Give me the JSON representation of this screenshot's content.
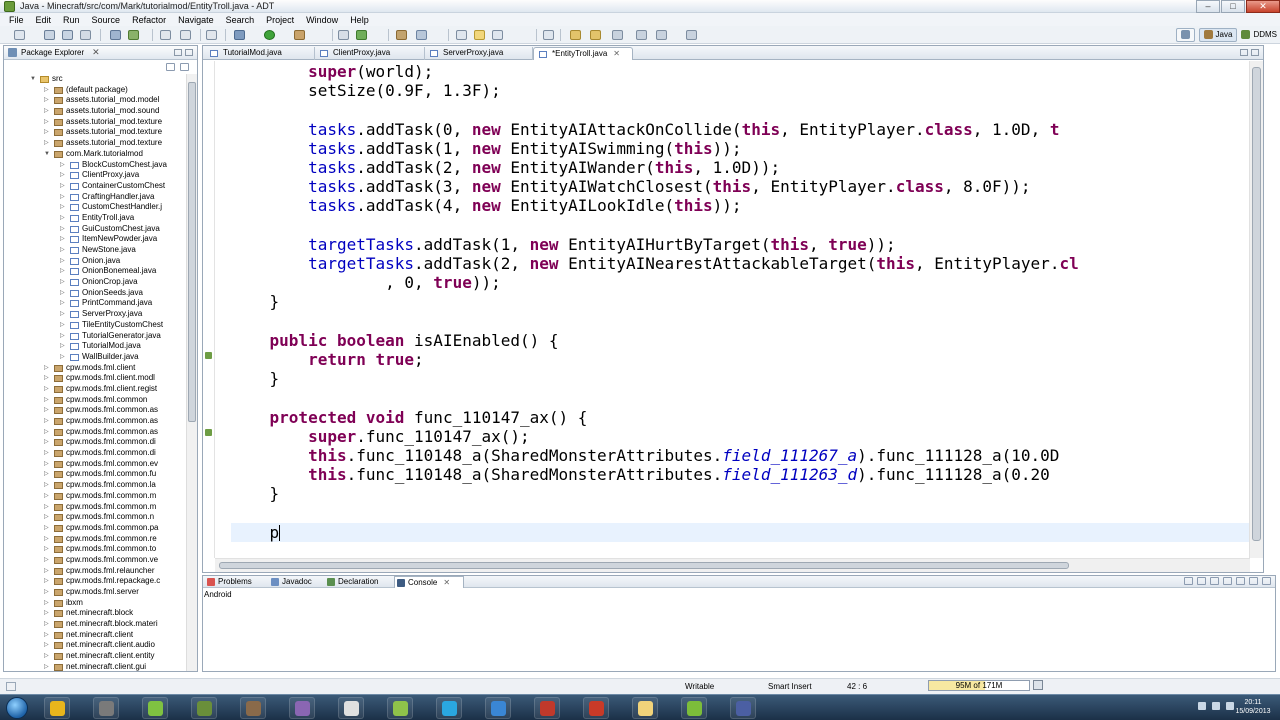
{
  "window": {
    "title": "Java - Minecraft/src/com/Mark/tutorialmod/EntityTroll.java - ADT",
    "minimize": "–",
    "maximize": "□",
    "close": "✕"
  },
  "menu": [
    "File",
    "Edit",
    "Run",
    "Source",
    "Refactor",
    "Navigate",
    "Search",
    "Project",
    "Window",
    "Help"
  ],
  "perspectives": {
    "java": "Java",
    "ddms": "DDMS"
  },
  "package_explorer": {
    "title": "Package Explorer",
    "close": "✕",
    "tree": [
      {
        "label": "src",
        "level": 1,
        "icon": "folder",
        "twisty": "▼"
      },
      {
        "label": "(default package)",
        "level": 2,
        "icon": "pkg",
        "twisty": "▷"
      },
      {
        "label": "assets.tutorial_mod.model",
        "level": 2,
        "icon": "pkg",
        "twisty": "▷"
      },
      {
        "label": "assets.tutorial_mod.sound",
        "level": 2,
        "icon": "pkg",
        "twisty": "▷"
      },
      {
        "label": "assets.tutorial_mod.texture",
        "level": 2,
        "icon": "pkg",
        "twisty": "▷"
      },
      {
        "label": "assets.tutorial_mod.texture",
        "level": 2,
        "icon": "pkg",
        "twisty": "▷"
      },
      {
        "label": "assets.tutorial_mod.texture",
        "level": 2,
        "icon": "pkg",
        "twisty": "▷"
      },
      {
        "label": "com.Mark.tutorialmod",
        "level": 2,
        "icon": "pkg",
        "twisty": "▼"
      },
      {
        "label": "BlockCustomChest.java",
        "level": 3,
        "icon": "java",
        "twisty": "▷"
      },
      {
        "label": "ClientProxy.java",
        "level": 3,
        "icon": "java",
        "twisty": "▷"
      },
      {
        "label": "ContainerCustomChest",
        "level": 3,
        "icon": "java",
        "twisty": "▷"
      },
      {
        "label": "CraftingHandler.java",
        "level": 3,
        "icon": "java",
        "twisty": "▷"
      },
      {
        "label": "CustomChestHandler.j",
        "level": 3,
        "icon": "java",
        "twisty": "▷"
      },
      {
        "label": "EntityTroll.java",
        "level": 3,
        "icon": "java",
        "twisty": "▷"
      },
      {
        "label": "GuiCustomChest.java",
        "level": 3,
        "icon": "java",
        "twisty": "▷"
      },
      {
        "label": "ItemNewPowder.java",
        "level": 3,
        "icon": "java",
        "twisty": "▷"
      },
      {
        "label": "NewStone.java",
        "level": 3,
        "icon": "java",
        "twisty": "▷"
      },
      {
        "label": "Onion.java",
        "level": 3,
        "icon": "java",
        "twisty": "▷"
      },
      {
        "label": "OnionBonemeal.java",
        "level": 3,
        "icon": "java",
        "twisty": "▷"
      },
      {
        "label": "OnionCrop.java",
        "level": 3,
        "icon": "java",
        "twisty": "▷"
      },
      {
        "label": "OnionSeeds.java",
        "level": 3,
        "icon": "java",
        "twisty": "▷"
      },
      {
        "label": "PrintCommand.java",
        "level": 3,
        "icon": "java",
        "twisty": "▷"
      },
      {
        "label": "ServerProxy.java",
        "level": 3,
        "icon": "java",
        "twisty": "▷"
      },
      {
        "label": "TileEntityCustomChest",
        "level": 3,
        "icon": "java",
        "twisty": "▷"
      },
      {
        "label": "TutorialGenerator.java",
        "level": 3,
        "icon": "java",
        "twisty": "▷"
      },
      {
        "label": "TutorialMod.java",
        "level": 3,
        "icon": "java",
        "twisty": "▷"
      },
      {
        "label": "WallBuilder.java",
        "level": 3,
        "icon": "java",
        "twisty": "▷"
      },
      {
        "label": "cpw.mods.fml.client",
        "level": 2,
        "icon": "pkg",
        "twisty": "▷"
      },
      {
        "label": "cpw.mods.fml.client.modl",
        "level": 2,
        "icon": "pkg",
        "twisty": "▷"
      },
      {
        "label": "cpw.mods.fml.client.regist",
        "level": 2,
        "icon": "pkg",
        "twisty": "▷"
      },
      {
        "label": "cpw.mods.fml.common",
        "level": 2,
        "icon": "pkg",
        "twisty": "▷"
      },
      {
        "label": "cpw.mods.fml.common.as",
        "level": 2,
        "icon": "pkg",
        "twisty": "▷"
      },
      {
        "label": "cpw.mods.fml.common.as",
        "level": 2,
        "icon": "pkg",
        "twisty": "▷"
      },
      {
        "label": "cpw.mods.fml.common.as",
        "level": 2,
        "icon": "pkg",
        "twisty": "▷"
      },
      {
        "label": "cpw.mods.fml.common.di",
        "level": 2,
        "icon": "pkg",
        "twisty": "▷"
      },
      {
        "label": "cpw.mods.fml.common.di",
        "level": 2,
        "icon": "pkg",
        "twisty": "▷"
      },
      {
        "label": "cpw.mods.fml.common.ev",
        "level": 2,
        "icon": "pkg",
        "twisty": "▷"
      },
      {
        "label": "cpw.mods.fml.common.fu",
        "level": 2,
        "icon": "pkg",
        "twisty": "▷"
      },
      {
        "label": "cpw.mods.fml.common.la",
        "level": 2,
        "icon": "pkg",
        "twisty": "▷"
      },
      {
        "label": "cpw.mods.fml.common.m",
        "level": 2,
        "icon": "pkg",
        "twisty": "▷"
      },
      {
        "label": "cpw.mods.fml.common.m",
        "level": 2,
        "icon": "pkg",
        "twisty": "▷"
      },
      {
        "label": "cpw.mods.fml.common.n",
        "level": 2,
        "icon": "pkg",
        "twisty": "▷"
      },
      {
        "label": "cpw.mods.fml.common.pa",
        "level": 2,
        "icon": "pkg",
        "twisty": "▷"
      },
      {
        "label": "cpw.mods.fml.common.re",
        "level": 2,
        "icon": "pkg",
        "twisty": "▷"
      },
      {
        "label": "cpw.mods.fml.common.to",
        "level": 2,
        "icon": "pkg",
        "twisty": "▷"
      },
      {
        "label": "cpw.mods.fml.common.ve",
        "level": 2,
        "icon": "pkg",
        "twisty": "▷"
      },
      {
        "label": "cpw.mods.fml.relauncher",
        "level": 2,
        "icon": "pkg",
        "twisty": "▷"
      },
      {
        "label": "cpw.mods.fml.repackage.c",
        "level": 2,
        "icon": "pkg",
        "twisty": "▷"
      },
      {
        "label": "cpw.mods.fml.server",
        "level": 2,
        "icon": "pkg",
        "twisty": "▷"
      },
      {
        "label": "ibxm",
        "level": 2,
        "icon": "pkg",
        "twisty": "▷"
      },
      {
        "label": "net.minecraft.block",
        "level": 2,
        "icon": "pkg",
        "twisty": "▷"
      },
      {
        "label": "net.minecraft.block.materi",
        "level": 2,
        "icon": "pkg",
        "twisty": "▷"
      },
      {
        "label": "net.minecraft.client",
        "level": 2,
        "icon": "pkg",
        "twisty": "▷"
      },
      {
        "label": "net.minecraft.client.audio",
        "level": 2,
        "icon": "pkg",
        "twisty": "▷"
      },
      {
        "label": "net.minecraft.client.entity",
        "level": 2,
        "icon": "pkg",
        "twisty": "▷"
      },
      {
        "label": "net.minecraft.client.gui",
        "level": 2,
        "icon": "pkg",
        "twisty": "▷"
      }
    ]
  },
  "editor": {
    "tabs": [
      {
        "label": "TutorialMod.java",
        "active": false
      },
      {
        "label": "ClientProxy.java",
        "active": false
      },
      {
        "label": "ServerProxy.java",
        "active": false
      },
      {
        "label": "*EntityTroll.java",
        "active": true
      }
    ],
    "tab_close": "✕",
    "code_lines": [
      [
        {
          "t": "        "
        },
        {
          "t": "super",
          "c": "kw"
        },
        {
          "t": "(world);"
        }
      ],
      [
        {
          "t": "        setSize(0.9F, 1.3F);"
        }
      ],
      [
        {
          "t": ""
        }
      ],
      [
        {
          "t": "        "
        },
        {
          "t": "tasks",
          "c": "fld"
        },
        {
          "t": ".addTask(0, "
        },
        {
          "t": "new",
          "c": "kw"
        },
        {
          "t": " EntityAIAttackOnCollide("
        },
        {
          "t": "this",
          "c": "kw"
        },
        {
          "t": ", EntityPlayer."
        },
        {
          "t": "class",
          "c": "kw"
        },
        {
          "t": ", 1.0D, "
        },
        {
          "t": "t",
          "c": "kw"
        }
      ],
      [
        {
          "t": "        "
        },
        {
          "t": "tasks",
          "c": "fld"
        },
        {
          "t": ".addTask(1, "
        },
        {
          "t": "new",
          "c": "kw"
        },
        {
          "t": " EntityAISwimming("
        },
        {
          "t": "this",
          "c": "kw"
        },
        {
          "t": "));"
        }
      ],
      [
        {
          "t": "        "
        },
        {
          "t": "tasks",
          "c": "fld"
        },
        {
          "t": ".addTask(2, "
        },
        {
          "t": "new",
          "c": "kw"
        },
        {
          "t": " EntityAIWander("
        },
        {
          "t": "this",
          "c": "kw"
        },
        {
          "t": ", 1.0D));"
        }
      ],
      [
        {
          "t": "        "
        },
        {
          "t": "tasks",
          "c": "fld"
        },
        {
          "t": ".addTask(3, "
        },
        {
          "t": "new",
          "c": "kw"
        },
        {
          "t": " EntityAIWatchClosest("
        },
        {
          "t": "this",
          "c": "kw"
        },
        {
          "t": ", EntityPlayer."
        },
        {
          "t": "class",
          "c": "kw"
        },
        {
          "t": ", 8.0F));"
        }
      ],
      [
        {
          "t": "        "
        },
        {
          "t": "tasks",
          "c": "fld"
        },
        {
          "t": ".addTask(4, "
        },
        {
          "t": "new",
          "c": "kw"
        },
        {
          "t": " EntityAILookIdle("
        },
        {
          "t": "this",
          "c": "kw"
        },
        {
          "t": "));"
        }
      ],
      [
        {
          "t": ""
        }
      ],
      [
        {
          "t": "        "
        },
        {
          "t": "targetTasks",
          "c": "fld"
        },
        {
          "t": ".addTask(1, "
        },
        {
          "t": "new",
          "c": "kw"
        },
        {
          "t": " EntityAIHurtByTarget("
        },
        {
          "t": "this",
          "c": "kw"
        },
        {
          "t": ", "
        },
        {
          "t": "true",
          "c": "kw"
        },
        {
          "t": "));"
        }
      ],
      [
        {
          "t": "        "
        },
        {
          "t": "targetTasks",
          "c": "fld"
        },
        {
          "t": ".addTask(2, "
        },
        {
          "t": "new",
          "c": "kw"
        },
        {
          "t": " EntityAINearestAttackableTarget("
        },
        {
          "t": "this",
          "c": "kw"
        },
        {
          "t": ", EntityPlayer."
        },
        {
          "t": "cl",
          "c": "kw"
        }
      ],
      [
        {
          "t": "                , 0, "
        },
        {
          "t": "true",
          "c": "kw"
        },
        {
          "t": "));"
        }
      ],
      [
        {
          "t": "    }"
        }
      ],
      [
        {
          "t": ""
        }
      ],
      [
        {
          "t": "    "
        },
        {
          "t": "public",
          "c": "kw"
        },
        {
          "t": " "
        },
        {
          "t": "boolean",
          "c": "kw"
        },
        {
          "t": " isAIEnabled() {"
        }
      ],
      [
        {
          "t": "        "
        },
        {
          "t": "return",
          "c": "kw"
        },
        {
          "t": " "
        },
        {
          "t": "true",
          "c": "kw"
        },
        {
          "t": ";"
        }
      ],
      [
        {
          "t": "    }"
        }
      ],
      [
        {
          "t": ""
        }
      ],
      [
        {
          "t": "    "
        },
        {
          "t": "protected",
          "c": "kw"
        },
        {
          "t": " "
        },
        {
          "t": "void",
          "c": "kw"
        },
        {
          "t": " func_110147_ax() {"
        }
      ],
      [
        {
          "t": "        "
        },
        {
          "t": "super",
          "c": "kw"
        },
        {
          "t": ".func_110147_ax();"
        }
      ],
      [
        {
          "t": "        "
        },
        {
          "t": "this",
          "c": "kw"
        },
        {
          "t": ".func_110148_a(SharedMonsterAttributes."
        },
        {
          "t": "field_111267_a",
          "c": "it"
        },
        {
          "t": ").func_111128_a(10.0D"
        }
      ],
      [
        {
          "t": "        "
        },
        {
          "t": "this",
          "c": "kw"
        },
        {
          "t": ".func_110148_a(SharedMonsterAttributes."
        },
        {
          "t": "field_111263_d",
          "c": "it"
        },
        {
          "t": ").func_111128_a(0.20"
        }
      ],
      [
        {
          "t": "    }"
        }
      ],
      [
        {
          "t": ""
        }
      ],
      [
        {
          "t": "    p"
        }
      ]
    ]
  },
  "bottom_panel": {
    "tabs": [
      {
        "label": "Problems",
        "active": false
      },
      {
        "label": "Javadoc",
        "active": false
      },
      {
        "label": "Declaration",
        "active": false
      },
      {
        "label": "Console",
        "active": true
      }
    ],
    "console_close": "✕",
    "console_label": "Android"
  },
  "status": {
    "writable": "Writable",
    "insert_mode": "Smart Insert",
    "position": "42 : 6",
    "heap": "95M of 171M",
    "heap_fraction": 0.56
  },
  "taskbar": {
    "time": "20:11",
    "date": "15/09/2013",
    "apps": [
      {
        "name": "chrome-icon",
        "color": "#e8b51c"
      },
      {
        "name": "minecraft-launcher-icon",
        "color": "#7a7a7a"
      },
      {
        "name": "spotify-icon",
        "color": "#7fc241"
      },
      {
        "name": "minecraft-icon",
        "color": "#6a8f3a"
      },
      {
        "name": "game-icon",
        "color": "#8a6a4a"
      },
      {
        "name": "purple-app-icon",
        "color": "#8a66b3"
      },
      {
        "name": "fraps-icon",
        "color": "#e0e0e0"
      },
      {
        "name": "notepad-plus-icon",
        "color": "#8fc24a"
      },
      {
        "name": "skype-icon",
        "color": "#2aa7e1"
      },
      {
        "name": "media-player-icon",
        "color": "#3a86d4"
      },
      {
        "name": "ccleaner-icon",
        "color": "#c0392b"
      },
      {
        "name": "filezilla-icon",
        "color": "#c83a28"
      },
      {
        "name": "explorer-icon",
        "color": "#f1d37a"
      },
      {
        "name": "android-icon",
        "color": "#7cbd3a"
      },
      {
        "name": "eclipse-icon",
        "color": "#4b5fa3"
      }
    ]
  }
}
